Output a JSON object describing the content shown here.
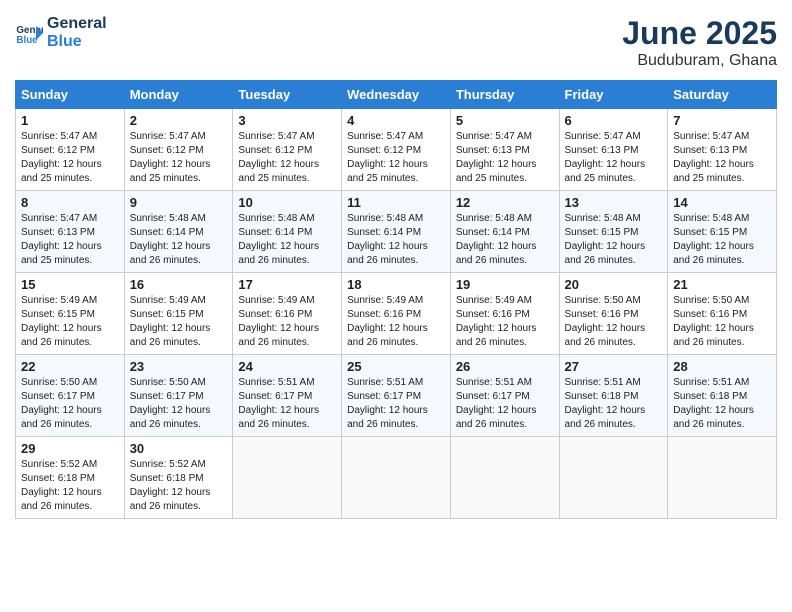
{
  "logo": {
    "line1": "General",
    "line2": "Blue"
  },
  "title": "June 2025",
  "location": "Buduburam, Ghana",
  "weekdays": [
    "Sunday",
    "Monday",
    "Tuesday",
    "Wednesday",
    "Thursday",
    "Friday",
    "Saturday"
  ],
  "weeks": [
    [
      {
        "day": "1",
        "sunrise": "5:47 AM",
        "sunset": "6:12 PM",
        "daylight": "12 hours and 25 minutes."
      },
      {
        "day": "2",
        "sunrise": "5:47 AM",
        "sunset": "6:12 PM",
        "daylight": "12 hours and 25 minutes."
      },
      {
        "day": "3",
        "sunrise": "5:47 AM",
        "sunset": "6:12 PM",
        "daylight": "12 hours and 25 minutes."
      },
      {
        "day": "4",
        "sunrise": "5:47 AM",
        "sunset": "6:12 PM",
        "daylight": "12 hours and 25 minutes."
      },
      {
        "day": "5",
        "sunrise": "5:47 AM",
        "sunset": "6:13 PM",
        "daylight": "12 hours and 25 minutes."
      },
      {
        "day": "6",
        "sunrise": "5:47 AM",
        "sunset": "6:13 PM",
        "daylight": "12 hours and 25 minutes."
      },
      {
        "day": "7",
        "sunrise": "5:47 AM",
        "sunset": "6:13 PM",
        "daylight": "12 hours and 25 minutes."
      }
    ],
    [
      {
        "day": "8",
        "sunrise": "5:47 AM",
        "sunset": "6:13 PM",
        "daylight": "12 hours and 25 minutes."
      },
      {
        "day": "9",
        "sunrise": "5:48 AM",
        "sunset": "6:14 PM",
        "daylight": "12 hours and 26 minutes."
      },
      {
        "day": "10",
        "sunrise": "5:48 AM",
        "sunset": "6:14 PM",
        "daylight": "12 hours and 26 minutes."
      },
      {
        "day": "11",
        "sunrise": "5:48 AM",
        "sunset": "6:14 PM",
        "daylight": "12 hours and 26 minutes."
      },
      {
        "day": "12",
        "sunrise": "5:48 AM",
        "sunset": "6:14 PM",
        "daylight": "12 hours and 26 minutes."
      },
      {
        "day": "13",
        "sunrise": "5:48 AM",
        "sunset": "6:15 PM",
        "daylight": "12 hours and 26 minutes."
      },
      {
        "day": "14",
        "sunrise": "5:48 AM",
        "sunset": "6:15 PM",
        "daylight": "12 hours and 26 minutes."
      }
    ],
    [
      {
        "day": "15",
        "sunrise": "5:49 AM",
        "sunset": "6:15 PM",
        "daylight": "12 hours and 26 minutes."
      },
      {
        "day": "16",
        "sunrise": "5:49 AM",
        "sunset": "6:15 PM",
        "daylight": "12 hours and 26 minutes."
      },
      {
        "day": "17",
        "sunrise": "5:49 AM",
        "sunset": "6:16 PM",
        "daylight": "12 hours and 26 minutes."
      },
      {
        "day": "18",
        "sunrise": "5:49 AM",
        "sunset": "6:16 PM",
        "daylight": "12 hours and 26 minutes."
      },
      {
        "day": "19",
        "sunrise": "5:49 AM",
        "sunset": "6:16 PM",
        "daylight": "12 hours and 26 minutes."
      },
      {
        "day": "20",
        "sunrise": "5:50 AM",
        "sunset": "6:16 PM",
        "daylight": "12 hours and 26 minutes."
      },
      {
        "day": "21",
        "sunrise": "5:50 AM",
        "sunset": "6:16 PM",
        "daylight": "12 hours and 26 minutes."
      }
    ],
    [
      {
        "day": "22",
        "sunrise": "5:50 AM",
        "sunset": "6:17 PM",
        "daylight": "12 hours and 26 minutes."
      },
      {
        "day": "23",
        "sunrise": "5:50 AM",
        "sunset": "6:17 PM",
        "daylight": "12 hours and 26 minutes."
      },
      {
        "day": "24",
        "sunrise": "5:51 AM",
        "sunset": "6:17 PM",
        "daylight": "12 hours and 26 minutes."
      },
      {
        "day": "25",
        "sunrise": "5:51 AM",
        "sunset": "6:17 PM",
        "daylight": "12 hours and 26 minutes."
      },
      {
        "day": "26",
        "sunrise": "5:51 AM",
        "sunset": "6:17 PM",
        "daylight": "12 hours and 26 minutes."
      },
      {
        "day": "27",
        "sunrise": "5:51 AM",
        "sunset": "6:18 PM",
        "daylight": "12 hours and 26 minutes."
      },
      {
        "day": "28",
        "sunrise": "5:51 AM",
        "sunset": "6:18 PM",
        "daylight": "12 hours and 26 minutes."
      }
    ],
    [
      {
        "day": "29",
        "sunrise": "5:52 AM",
        "sunset": "6:18 PM",
        "daylight": "12 hours and 26 minutes."
      },
      {
        "day": "30",
        "sunrise": "5:52 AM",
        "sunset": "6:18 PM",
        "daylight": "12 hours and 26 minutes."
      },
      null,
      null,
      null,
      null,
      null
    ]
  ]
}
